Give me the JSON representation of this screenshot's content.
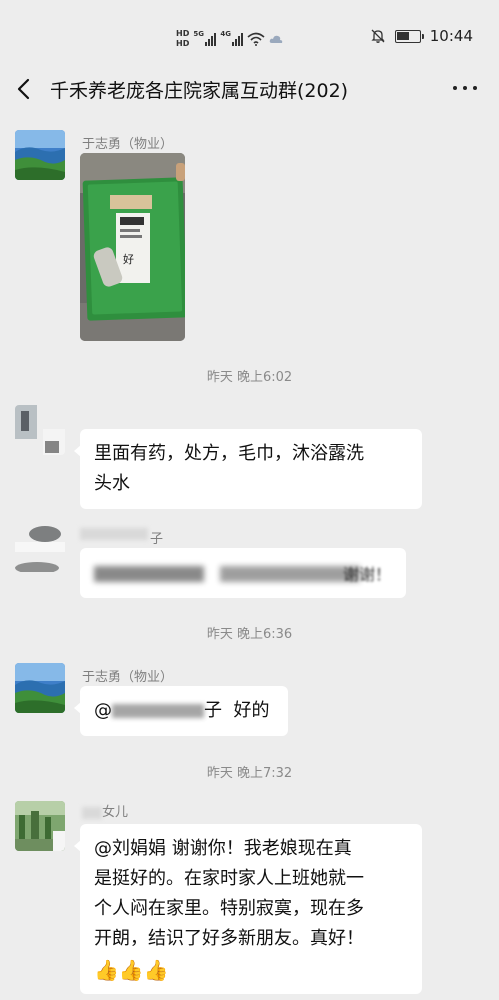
{
  "status_bar": {
    "hd_top": "HD",
    "hd_bottom": "HD",
    "sim1_label": "5G",
    "sim2_label": "4G",
    "clock": "10:44",
    "battery_level": 0.55
  },
  "header": {
    "title": "千禾养老庞各庄院家属互动群(202)"
  },
  "messages": [
    {
      "sender": "于志勇（物业）",
      "type": "image"
    },
    {
      "sender": "",
      "text_line1": "里面有药，处方，毛巾，沐浴露洗",
      "text_line2": "头水"
    },
    {
      "sender_partial": "子",
      "text_partial": "谢谢！"
    },
    {
      "sender": "于志勇（物业）",
      "mention": "@",
      "mention_tail": "子",
      "text": "好的"
    },
    {
      "sender_partial": "女儿",
      "text_line1": "@刘娟娟  谢谢你！我老娘现在真",
      "text_line2": "是挺好的。在家时家人上班她就一",
      "text_line3": "个人闷在家里。特别寂寞，现在多",
      "text_line4": "开朗，结识了好多新朋友。真好！",
      "emoji": "👍👍👍"
    }
  ],
  "timestamps": [
    "昨天 晚上6:02",
    "昨天 晚上6:36",
    "昨天 晚上7:32"
  ],
  "colors": {
    "background": "#ededed",
    "bubble": "#ffffff",
    "meta_text": "#8a8a8a"
  }
}
